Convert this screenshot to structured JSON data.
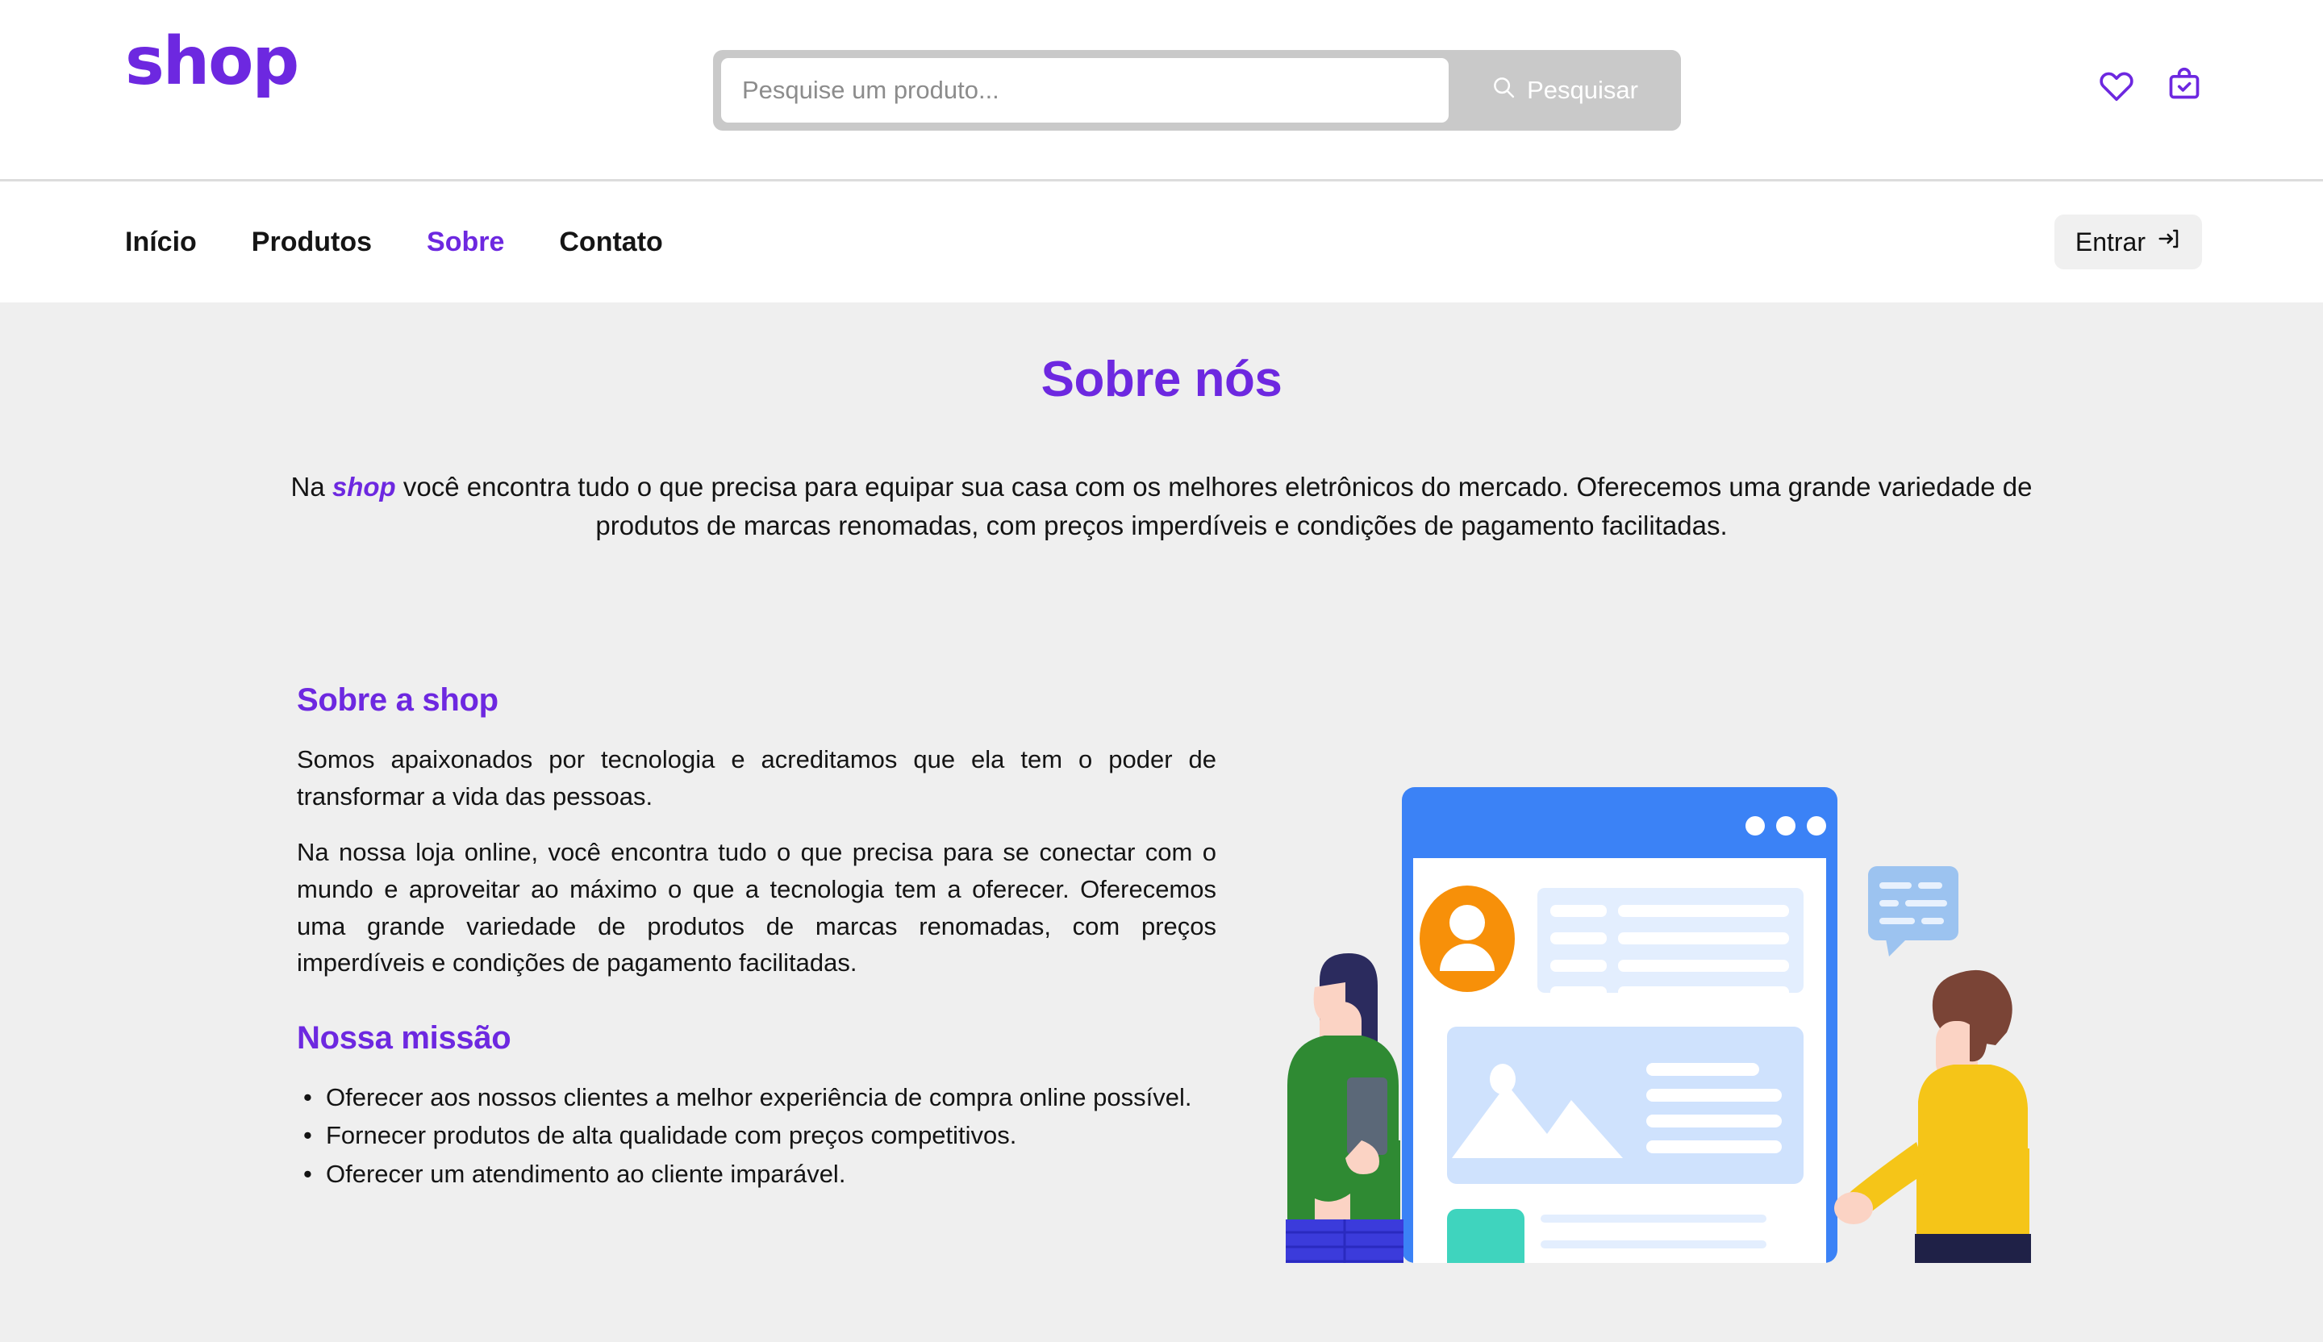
{
  "header": {
    "logo": "shop",
    "search": {
      "placeholder": "Pesquise um produto...",
      "value": "",
      "button_label": "Pesquisar",
      "button_icon": "search-icon"
    },
    "icons": [
      {
        "name": "heart-icon",
        "label": "Favoritos"
      },
      {
        "name": "shopping-bag-check-icon",
        "label": "Carrinho"
      }
    ],
    "accent_color": "#6d28e0",
    "search_button_color": "#c9c9c9"
  },
  "nav": {
    "links": [
      {
        "label": "Início",
        "active": false
      },
      {
        "label": "Produtos",
        "active": false
      },
      {
        "label": "Sobre",
        "active": true
      },
      {
        "label": "Contato",
        "active": false
      }
    ],
    "login": {
      "label": "Entrar",
      "icon": "login-arrow-icon"
    },
    "active_color": "#6d28e0"
  },
  "main": {
    "page_title": "Sobre nós",
    "intro": {
      "before": "Na ",
      "brand": "shop",
      "after": " você encontra tudo o que precisa para equipar sua casa com os melhores eletrônicos do mercado. Oferecemos uma grande variedade de produtos de marcas renomadas, com preços imperdíveis e condições de pagamento facilitadas."
    },
    "sections": [
      {
        "title": "Sobre a shop",
        "paragraphs": [
          "Somos apaixonados por tecnologia e acreditamos que ela tem o poder de transformar a vida das pessoas.",
          "Na nossa loja online, você encontra tudo o que precisa para se conectar com o mundo e aproveitar ao máximo o que a tecnologia tem a oferecer. Oferecemos uma grande variedade de produtos de marcas renomadas, com preços imperdíveis e condições de pagamento facilitadas."
        ]
      },
      {
        "title": "Nossa missão",
        "items": [
          "Oferecer aos nossos clientes a melhor experiência de compra online possível.",
          "Fornecer produtos de alta qualidade com preços competitivos.",
          "Oferecer um atendimento ao cliente imparável."
        ]
      }
    ],
    "illustration": {
      "name": "team-website-illustration",
      "alt": "Duas pessoas ao lado de uma janela de navegador com perfil, imagem e blocos de texto",
      "colors": {
        "browser_frame": "#3b82f6",
        "card_light": "#cfe2fd",
        "card_pale": "#e3eefe",
        "avatar": "#f79009",
        "teal_block": "#3fd4be",
        "person_left_shirt": "#2f8a33",
        "person_left_pants": "#3b3bdb",
        "person_left_hair": "#2b2b5e",
        "person_right_shirt": "#f5c518",
        "person_right_pants": "#1f2147",
        "person_right_hair": "#7a4436",
        "skin": "#fbd3c4",
        "chat_bubble": "#9cc3f0"
      }
    }
  },
  "page_background": "#efefef"
}
